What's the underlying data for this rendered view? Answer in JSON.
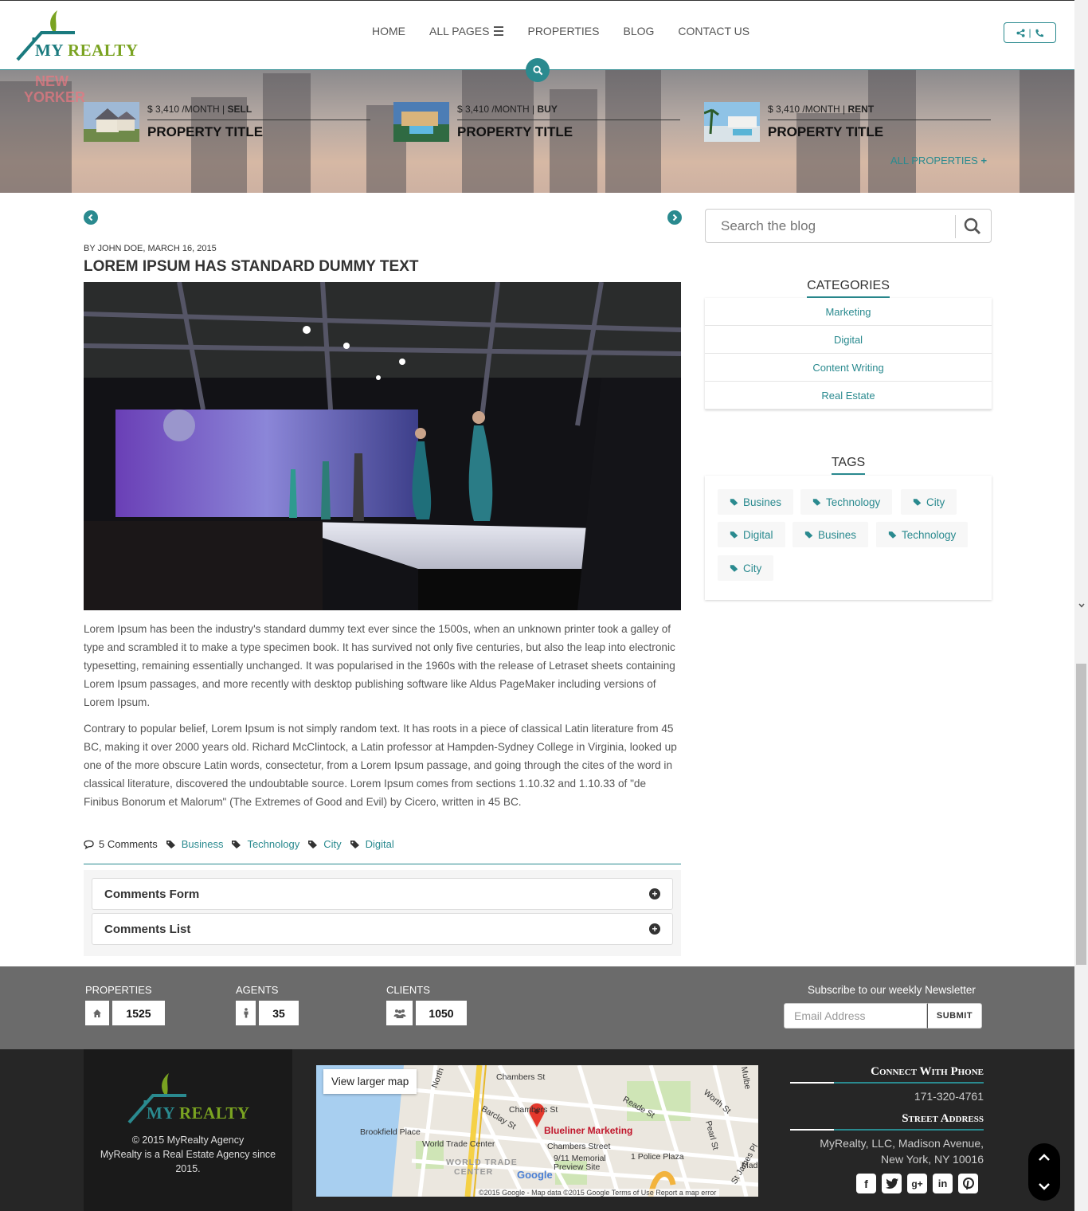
{
  "header": {
    "logo": {
      "word1": "MY",
      "word2": "REALTY"
    },
    "nav": [
      {
        "label": "HOME"
      },
      {
        "label": "ALL PAGES"
      },
      {
        "label": "PROPERTIES"
      },
      {
        "label": "BLOG"
      },
      {
        "label": "CONTACT US"
      }
    ],
    "contact_divider": "|"
  },
  "hero": {
    "neon_line1": "NEW",
    "neon_line2": "YORKER",
    "properties": [
      {
        "price": "$ 3,410 /MONTH",
        "type": "SELL",
        "title": "PROPERTY TITLE"
      },
      {
        "price": "$ 3,410 /MONTH",
        "type": "BUY",
        "title": "PROPERTY TITLE"
      },
      {
        "price": "$ 3,410 /MONTH",
        "type": "RENT",
        "title": "PROPERTY TITLE"
      }
    ],
    "all_properties": "ALL PROPERTIES"
  },
  "post": {
    "byline": "BY JOHN DOE, MARCH 16, 2015",
    "title": "LOREM IPSUM HAS STANDARD DUMMY TEXT",
    "paragraphs": [
      "Lorem Ipsum has been the industry's standard dummy text ever since the 1500s, when an unknown printer took a galley of type and scrambled it to make a type specimen book. It has survived not only five centuries, but also the leap into electronic typesetting, remaining essentially unchanged. It was popularised in the 1960s with the release of Letraset sheets containing Lorem Ipsum passages, and more recently with desktop publishing software like Aldus PageMaker including versions of Lorem Ipsum.",
      "Contrary to popular belief, Lorem Ipsum is not simply random text. It has roots in a piece of classical Latin literature from 45 BC, making it over 2000 years old. Richard McClintock, a Latin professor at Hampden-Sydney College in Virginia, looked up one of the more obscure Latin words, consectetur, from a Lorem Ipsum passage, and going through the cites of the word in classical literature, discovered the undoubtable source. Lorem Ipsum comes from sections 1.10.32 and 1.10.33 of \"de Finibus Bonorum et Malorum\" (The Extremes of Good and Evil) by Cicero, written in 45 BC."
    ],
    "comments_count": "5 Comments",
    "tags": [
      "Business",
      "Technology",
      "City",
      "Digital"
    ],
    "accordion": [
      "Comments Form",
      "Comments List"
    ]
  },
  "sidebar": {
    "search_placeholder": "Search the blog",
    "categories_heading": "CATEGORIES",
    "categories": [
      "Marketing",
      "Digital",
      "Content Writing",
      "Real Estate"
    ],
    "tags_heading": "TAGS",
    "tags": [
      "Busines",
      "Technology",
      "City",
      "Digital",
      "Busines",
      "Technology",
      "City"
    ]
  },
  "stats": {
    "items": [
      {
        "label": "PROPERTIES",
        "value": "1525",
        "icon": "home-icon"
      },
      {
        "label": "AGENTS",
        "value": "35",
        "icon": "person-icon"
      },
      {
        "label": "CLIENTS",
        "value": "1050",
        "icon": "users-icon"
      }
    ],
    "newsletter_label": "Subscribe to our weekly Newsletter",
    "email_placeholder": "Email Address",
    "submit_label": "SUBMIT"
  },
  "footer": {
    "copyright": "© 2015 MyRealty Agency",
    "tagline": "MyRealty is a Real Estate Agency since 2015.",
    "map": {
      "view_larger": "View larger map",
      "marker_label": "Blueliner Marketing",
      "labels": [
        "Chambers St",
        "Chambers St",
        "Reade St",
        "Worth St",
        "Barclay St",
        "Brookfield Place",
        "World Trade Center",
        "Chambers Street",
        "9/11 Memorial",
        "Preview Site",
        "1 Police Plaza",
        "North",
        "Pearl St",
        "WORLD TRADE",
        "CENTER",
        "St James Pl",
        "Mulbe",
        "Mad"
      ],
      "attribution": "©2015 Google - Map data ©2015 Google   Terms of Use   Report a map error",
      "google": "Google"
    },
    "connect_heading": "Connect With Phone",
    "phone": "171-320-4761",
    "address_heading": "Street Address",
    "address": "MyRealty, LLC, Madison Avenue, New York, NY 10016",
    "social": [
      "facebook-icon",
      "twitter-icon",
      "google-plus-icon",
      "linkedin-icon",
      "pinterest-icon"
    ]
  },
  "colors": {
    "accent": "#2a8a8f",
    "green": "#7aa321",
    "stats_bg": "#6b6b6b",
    "footer_bg": "#262626"
  }
}
